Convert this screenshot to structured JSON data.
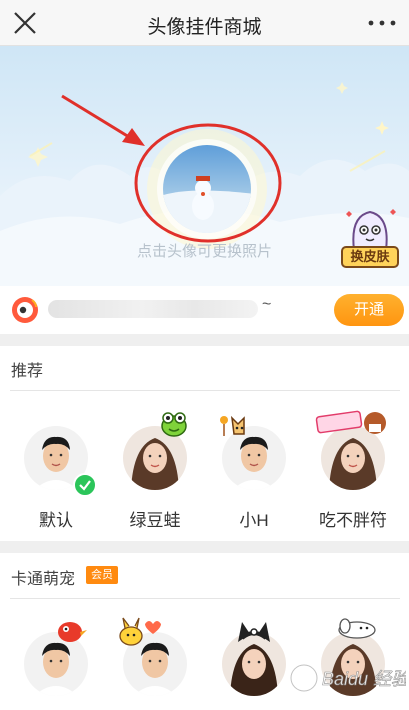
{
  "header": {
    "title": "头像挂件商城",
    "close_icon": "close-icon",
    "more_icon": "more-icon"
  },
  "hero": {
    "hint": "点击头像可更换照片",
    "skin_button_label": "换皮肤"
  },
  "member": {
    "username_suffix": "~",
    "open_label": "开通"
  },
  "sections": {
    "recommend": {
      "title": "推荐",
      "items": [
        {
          "name": "默认",
          "selected": true
        },
        {
          "name": "绿豆蛙"
        },
        {
          "name": "小H"
        },
        {
          "name": "吃不胖符"
        }
      ]
    },
    "cartoon": {
      "title": "卡通萌宠",
      "tag": "会员"
    }
  },
  "watermark": "Baidu 经验",
  "colors": {
    "accent": "#ff9a1a",
    "check": "#2bc55a",
    "annotation": "#e0302a"
  }
}
